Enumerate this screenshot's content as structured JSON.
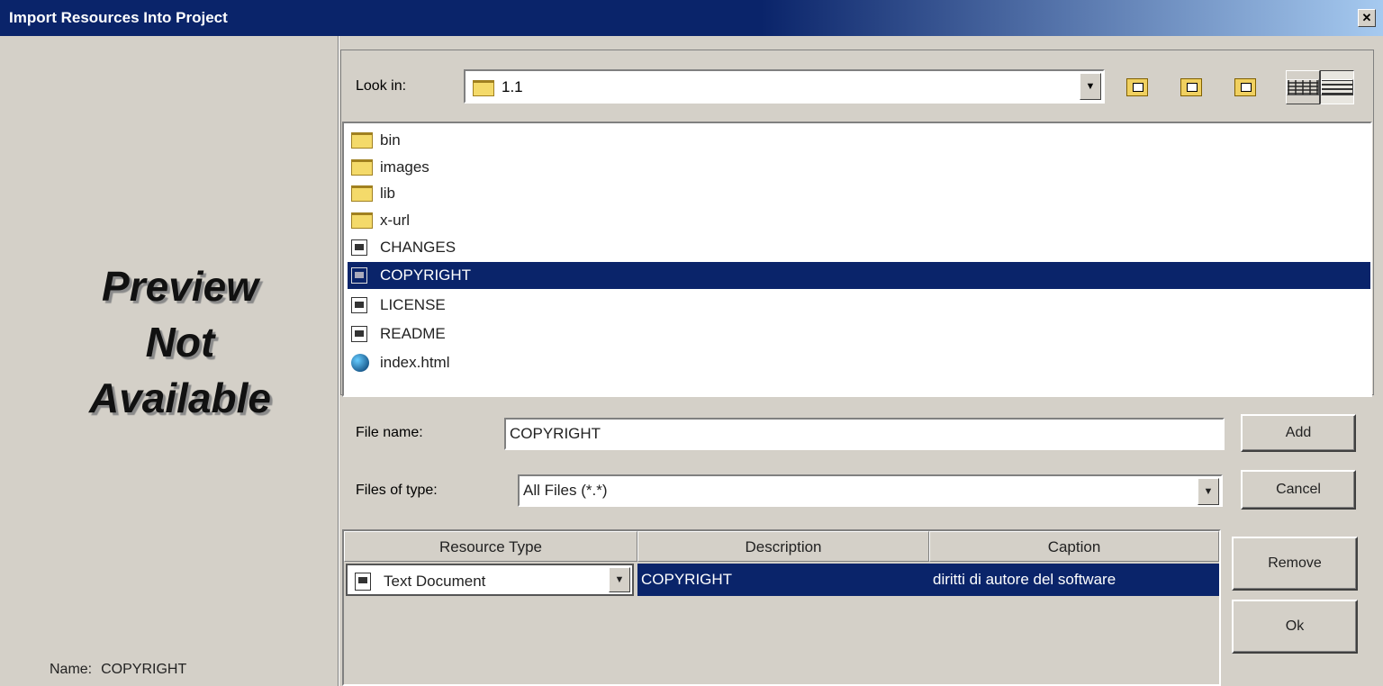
{
  "window": {
    "title": "Import Resources Into Project",
    "close_label": "✕"
  },
  "preview": {
    "lines": [
      "Preview",
      "Not",
      "Available"
    ],
    "name_label": "Name:",
    "name_value": "COPYRIGHT"
  },
  "lookin": {
    "label": "Look in:",
    "value": "1.1"
  },
  "files": [
    {
      "name": "bin",
      "icon": "folder-icon"
    },
    {
      "name": "images",
      "icon": "folder-icon"
    },
    {
      "name": "lib",
      "icon": "folder-icon"
    },
    {
      "name": "x-url",
      "icon": "folder-icon"
    },
    {
      "name": "CHANGES",
      "icon": "document-icon"
    },
    {
      "name": "COPYRIGHT",
      "icon": "document-icon",
      "selected": true
    },
    {
      "name": "LICENSE",
      "icon": "document-icon"
    },
    {
      "name": "README",
      "icon": "document-icon"
    },
    {
      "name": "index.html",
      "icon": "globe-icon"
    }
  ],
  "filename": {
    "label": "File name:",
    "value": "COPYRIGHT"
  },
  "filetype": {
    "label": "Files of type:",
    "value": "All Files (*.*)"
  },
  "buttons": {
    "add": "Add",
    "cancel": "Cancel",
    "remove": "Remove",
    "ok": "Ok"
  },
  "table": {
    "headers": [
      "Resource Type",
      "Description",
      "Caption"
    ],
    "rows": [
      {
        "type": "Text Document",
        "description": "COPYRIGHT",
        "caption": "diritti di autore del software"
      }
    ]
  },
  "colors": {
    "selection": "#0a246a",
    "face": "#d4d0c8"
  }
}
